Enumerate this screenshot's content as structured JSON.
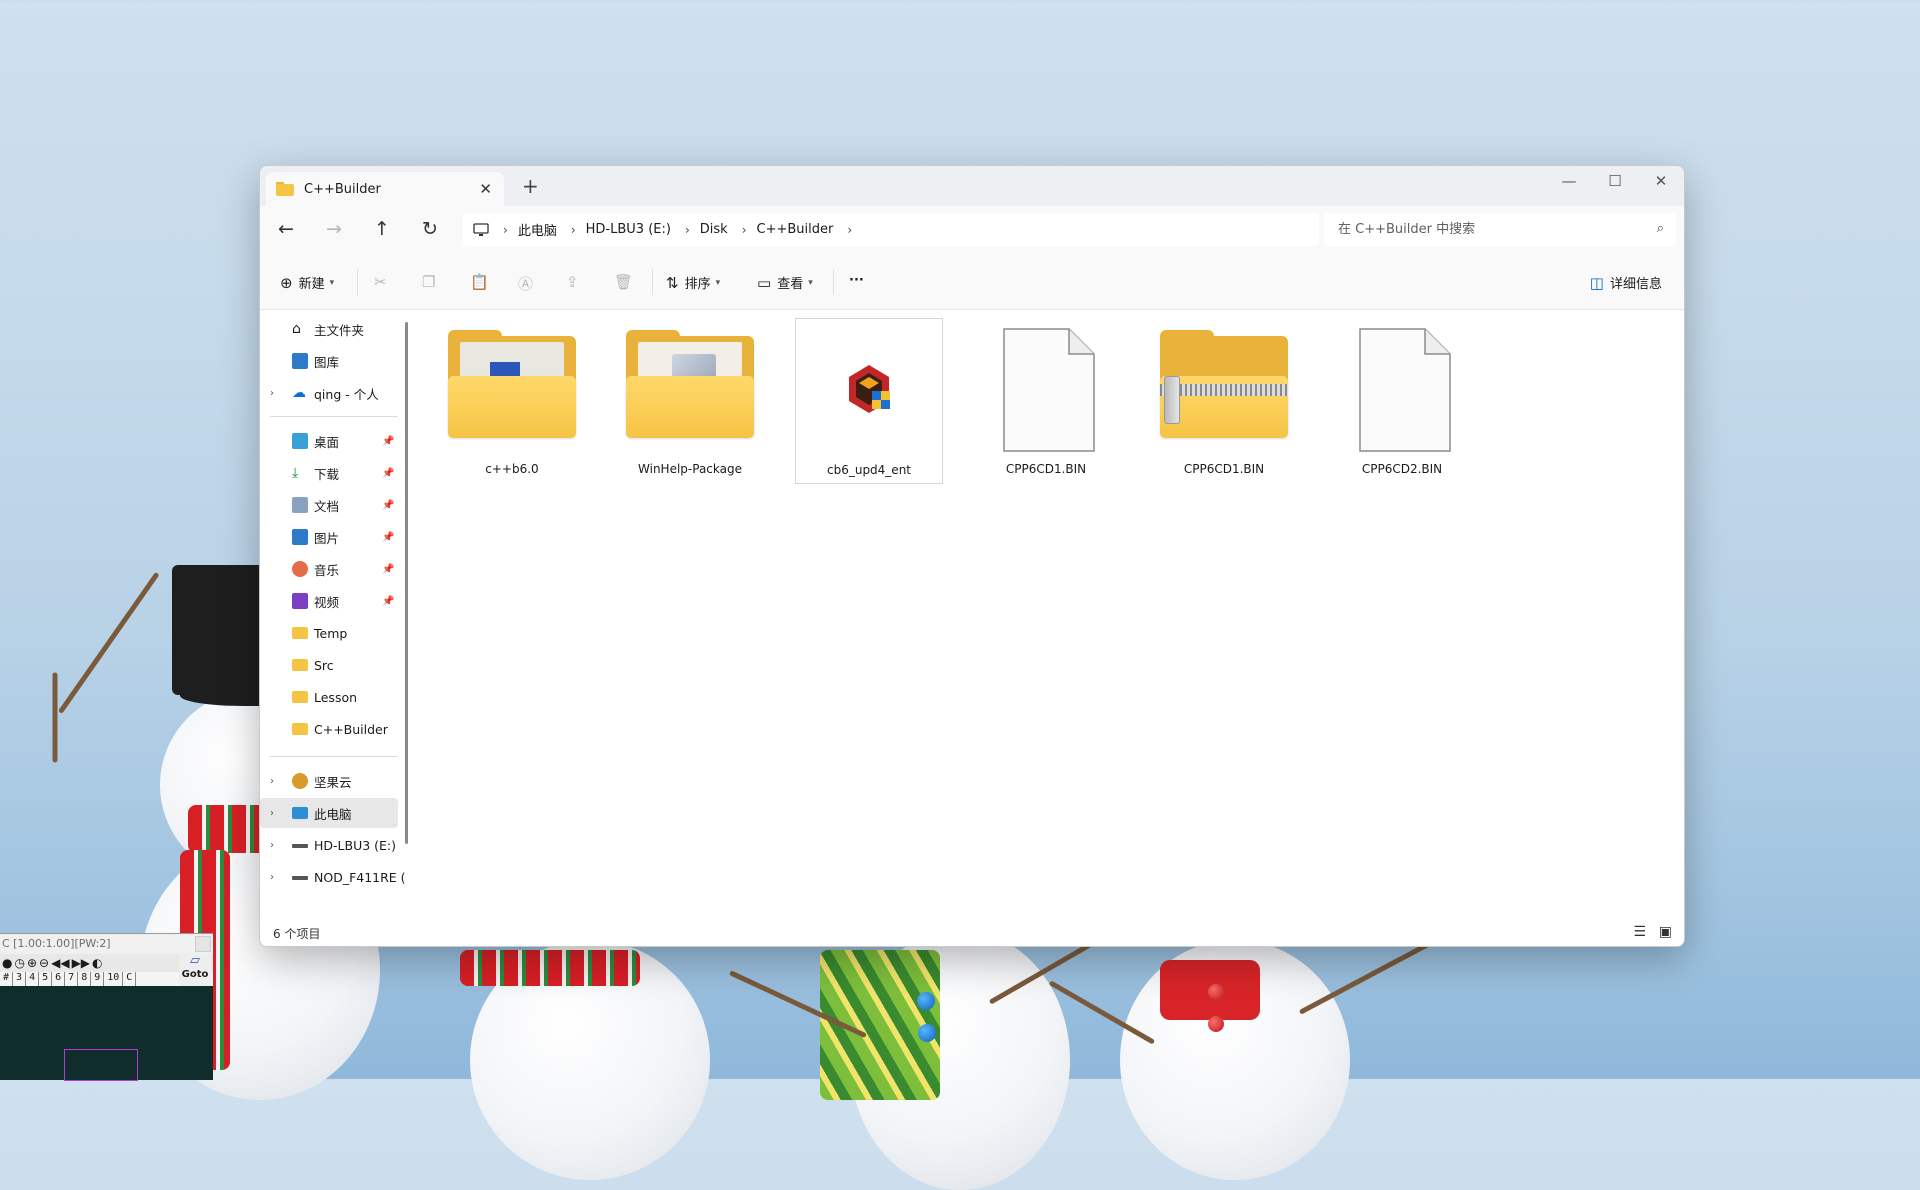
{
  "window": {
    "tab_title": "C++Builder",
    "new_tab": "+",
    "close_tab": "✕",
    "minimize": "—",
    "maximize": "☐",
    "close": "✕"
  },
  "nav_buttons": {
    "back": "←",
    "forward": "→",
    "up": "↑",
    "refresh": "↻"
  },
  "breadcrumb": [
    "此电脑",
    "HD-LBU3 (E:)",
    "Disk",
    "C++Builder"
  ],
  "search": {
    "placeholder": "在 C++Builder 中搜索",
    "icon": "search-icon"
  },
  "toolbar": {
    "new_label": "新建",
    "sort_label": "排序",
    "view_label": "查看",
    "more_label": "···",
    "details_label": "详细信息"
  },
  "sidebar": {
    "quick": [
      {
        "label": "主文件夹",
        "icon": "home-icon"
      },
      {
        "label": "图库",
        "icon": "gallery-icon"
      },
      {
        "label": "qing - 个人",
        "icon": "onedrive-icon",
        "expandable": true
      }
    ],
    "pinned": [
      {
        "label": "桌面",
        "icon": "desktop-icon"
      },
      {
        "label": "下载",
        "icon": "download-icon"
      },
      {
        "label": "文档",
        "icon": "documents-icon"
      },
      {
        "label": "图片",
        "icon": "pictures-icon"
      },
      {
        "label": "音乐",
        "icon": "music-icon"
      },
      {
        "label": "视频",
        "icon": "videos-icon"
      }
    ],
    "folders": [
      "Temp",
      "Src",
      "Lesson",
      "C++Builder"
    ],
    "drives": [
      {
        "label": "坚果云",
        "icon": "nutstore-icon"
      },
      {
        "label": "此电脑",
        "icon": "this-pc-icon",
        "selected": true
      },
      {
        "label": "HD-LBU3 (E:)",
        "icon": "drive-icon"
      },
      {
        "label": "NOD_F411RE (",
        "icon": "drive-icon"
      }
    ]
  },
  "files": [
    {
      "name": "c++b6.0",
      "type": "folder"
    },
    {
      "name": "WinHelp-Package",
      "type": "folder"
    },
    {
      "name": "cb6_upd4_ent",
      "type": "installer",
      "selected": true
    },
    {
      "name": "CPP6CD1.BIN",
      "type": "file"
    },
    {
      "name": "CPP6CD1.BIN",
      "type": "zip-folder"
    },
    {
      "name": "CPP6CD2.BIN",
      "type": "file"
    }
  ],
  "status": {
    "count": "6 个项目"
  },
  "tool_window": {
    "title": "C [1.00:1.00][PW:2]",
    "numbers": [
      "#",
      "3",
      "4",
      "5",
      "6",
      "7",
      "8",
      "9",
      "10",
      "C"
    ],
    "goto": "Goto"
  },
  "colors": {
    "folder": "#f6c445",
    "accent": "#0067c0"
  }
}
